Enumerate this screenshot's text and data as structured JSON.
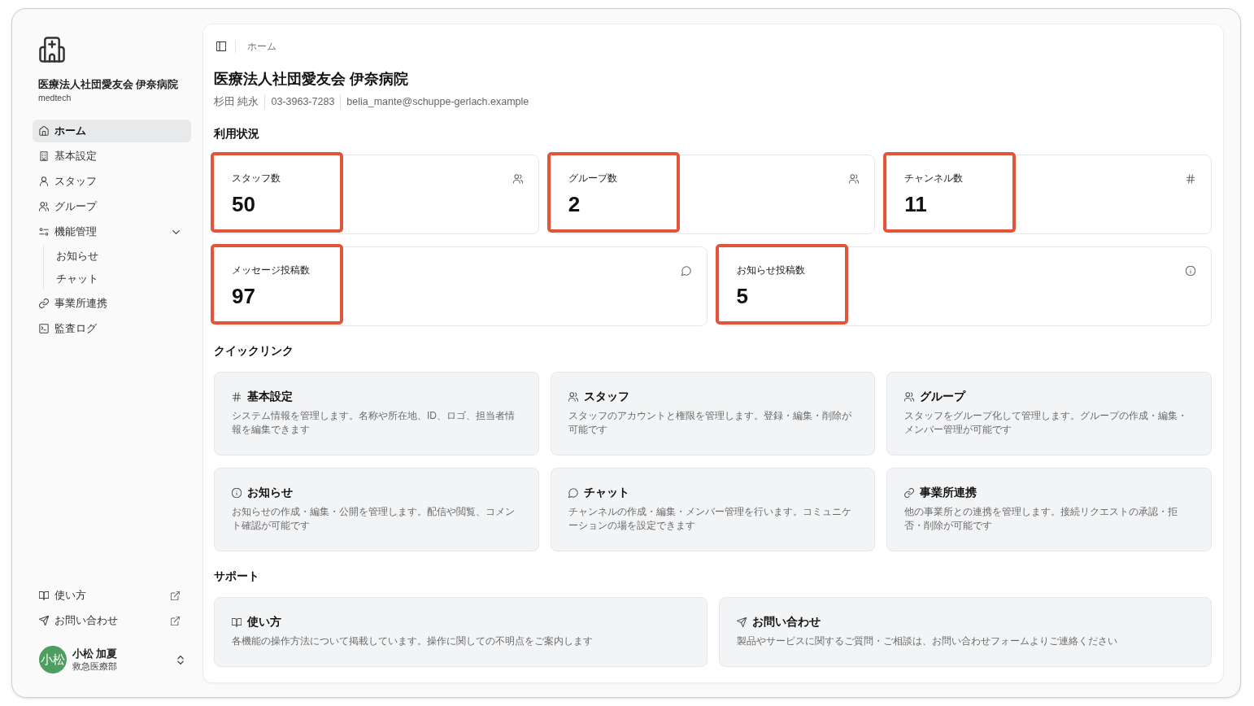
{
  "sidebar": {
    "org_name": "医療法人社団愛友会 伊奈病院",
    "org_subtitle": "medtech",
    "nav": [
      {
        "label": "ホーム",
        "kind": "home",
        "selected": true
      },
      {
        "label": "基本設定",
        "kind": "building",
        "selected": false
      },
      {
        "label": "スタッフ",
        "kind": "user",
        "selected": false
      },
      {
        "label": "グループ",
        "kind": "users",
        "selected": false
      },
      {
        "label": "機能管理",
        "kind": "sliders",
        "selected": false,
        "expanded": true,
        "children": [
          {
            "label": "お知らせ",
            "selected": false
          },
          {
            "label": "チャット",
            "selected": false
          }
        ]
      },
      {
        "label": "事業所連携",
        "kind": "link",
        "selected": false
      },
      {
        "label": "監査ログ",
        "kind": "terminal",
        "selected": false
      }
    ],
    "footer_links": [
      {
        "label": "使い方",
        "kind": "book"
      },
      {
        "label": "お問い合わせ",
        "kind": "send"
      }
    ],
    "user": {
      "avatar_text": "小松",
      "name": "小松 加夏",
      "department": "救急医療部"
    }
  },
  "breadcrumb": [
    "ホーム"
  ],
  "header": {
    "title": "医療法人社団愛友会 伊奈病院",
    "contact": [
      "杉田 純永",
      "03-3963-7283",
      "belia_mante@schuppe-gerlach.example"
    ]
  },
  "usage": {
    "heading": "利用状況",
    "stat_rows": [
      [
        {
          "label": "スタッフ数",
          "value": "50",
          "kind": "users",
          "highlighted": true
        },
        {
          "label": "グループ数",
          "value": "2",
          "kind": "users",
          "highlighted": true
        },
        {
          "label": "チャンネル数",
          "value": "11",
          "kind": "hash",
          "highlighted": true
        }
      ],
      [
        {
          "label": "メッセージ投稿数",
          "value": "97",
          "kind": "message",
          "highlighted": true
        },
        {
          "label": "お知らせ投稿数",
          "value": "5",
          "kind": "info",
          "highlighted": true
        }
      ]
    ]
  },
  "quick_links": {
    "heading": "クイックリンク",
    "items": [
      {
        "title": "基本設定",
        "kind": "hash",
        "description": "システム情報を管理します。名称や所在地、ID、ロゴ、担当者情報を編集できます"
      },
      {
        "title": "スタッフ",
        "kind": "users",
        "description": "スタッフのアカウントと権限を管理します。登録・編集・削除が可能です"
      },
      {
        "title": "グループ",
        "kind": "users",
        "description": "スタッフをグループ化して管理します。グループの作成・編集・メンバー管理が可能です"
      },
      {
        "title": "お知らせ",
        "kind": "info",
        "description": "お知らせの作成・編集・公開を管理します。配信や閲覧、コメント確認が可能です"
      },
      {
        "title": "チャット",
        "kind": "message",
        "description": "チャンネルの作成・編集・メンバー管理を行います。コミュニケーションの場を設定できます"
      },
      {
        "title": "事業所連携",
        "kind": "link",
        "description": "他の事業所との連携を管理します。接続リクエストの承認・拒否・削除が可能です"
      }
    ]
  },
  "support": {
    "heading": "サポート",
    "items": [
      {
        "title": "使い方",
        "kind": "book",
        "description": "各機能の操作方法について掲載しています。操作に関しての不明点をご案内します"
      },
      {
        "title": "お問い合わせ",
        "kind": "send",
        "description": "製品やサービスに関するご質問・ご相談は、お問い合わせフォームよりご連絡ください"
      }
    ]
  }
}
